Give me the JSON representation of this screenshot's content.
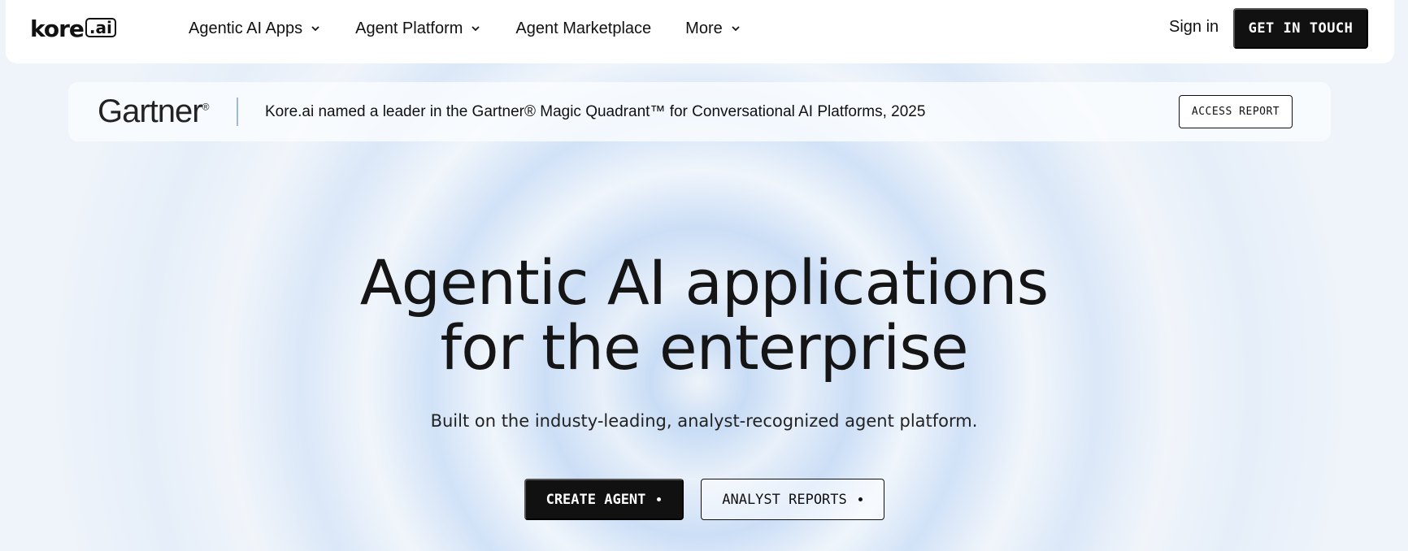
{
  "logo": {
    "text": "kore",
    "box": ".ai"
  },
  "nav": {
    "items": [
      {
        "label": "Agentic AI Apps",
        "has_dropdown": true
      },
      {
        "label": "Agent Platform",
        "has_dropdown": true
      },
      {
        "label": "Agent Marketplace",
        "has_dropdown": false
      },
      {
        "label": "More",
        "has_dropdown": true
      }
    ],
    "sign_in": "Sign in",
    "cta": "GET IN TOUCH"
  },
  "banner": {
    "brand": "Gartner",
    "brand_mark": "®",
    "text": "Kore.ai named a leader in the Gartner® Magic Quadrant™ for Conversational AI Platforms, 2025",
    "button": "ACCESS REPORT"
  },
  "hero": {
    "title_line1": "Agentic AI applications",
    "title_line2": "for the enterprise",
    "subtitle": "Built on the industy-leading, analyst-recognized agent platform.",
    "primary_cta": "CREATE AGENT",
    "secondary_cta": "ANALYST REPORTS"
  },
  "colors": {
    "primary": "#111111",
    "background": "#eef3f9",
    "accent_blue": "#c4daf5"
  }
}
